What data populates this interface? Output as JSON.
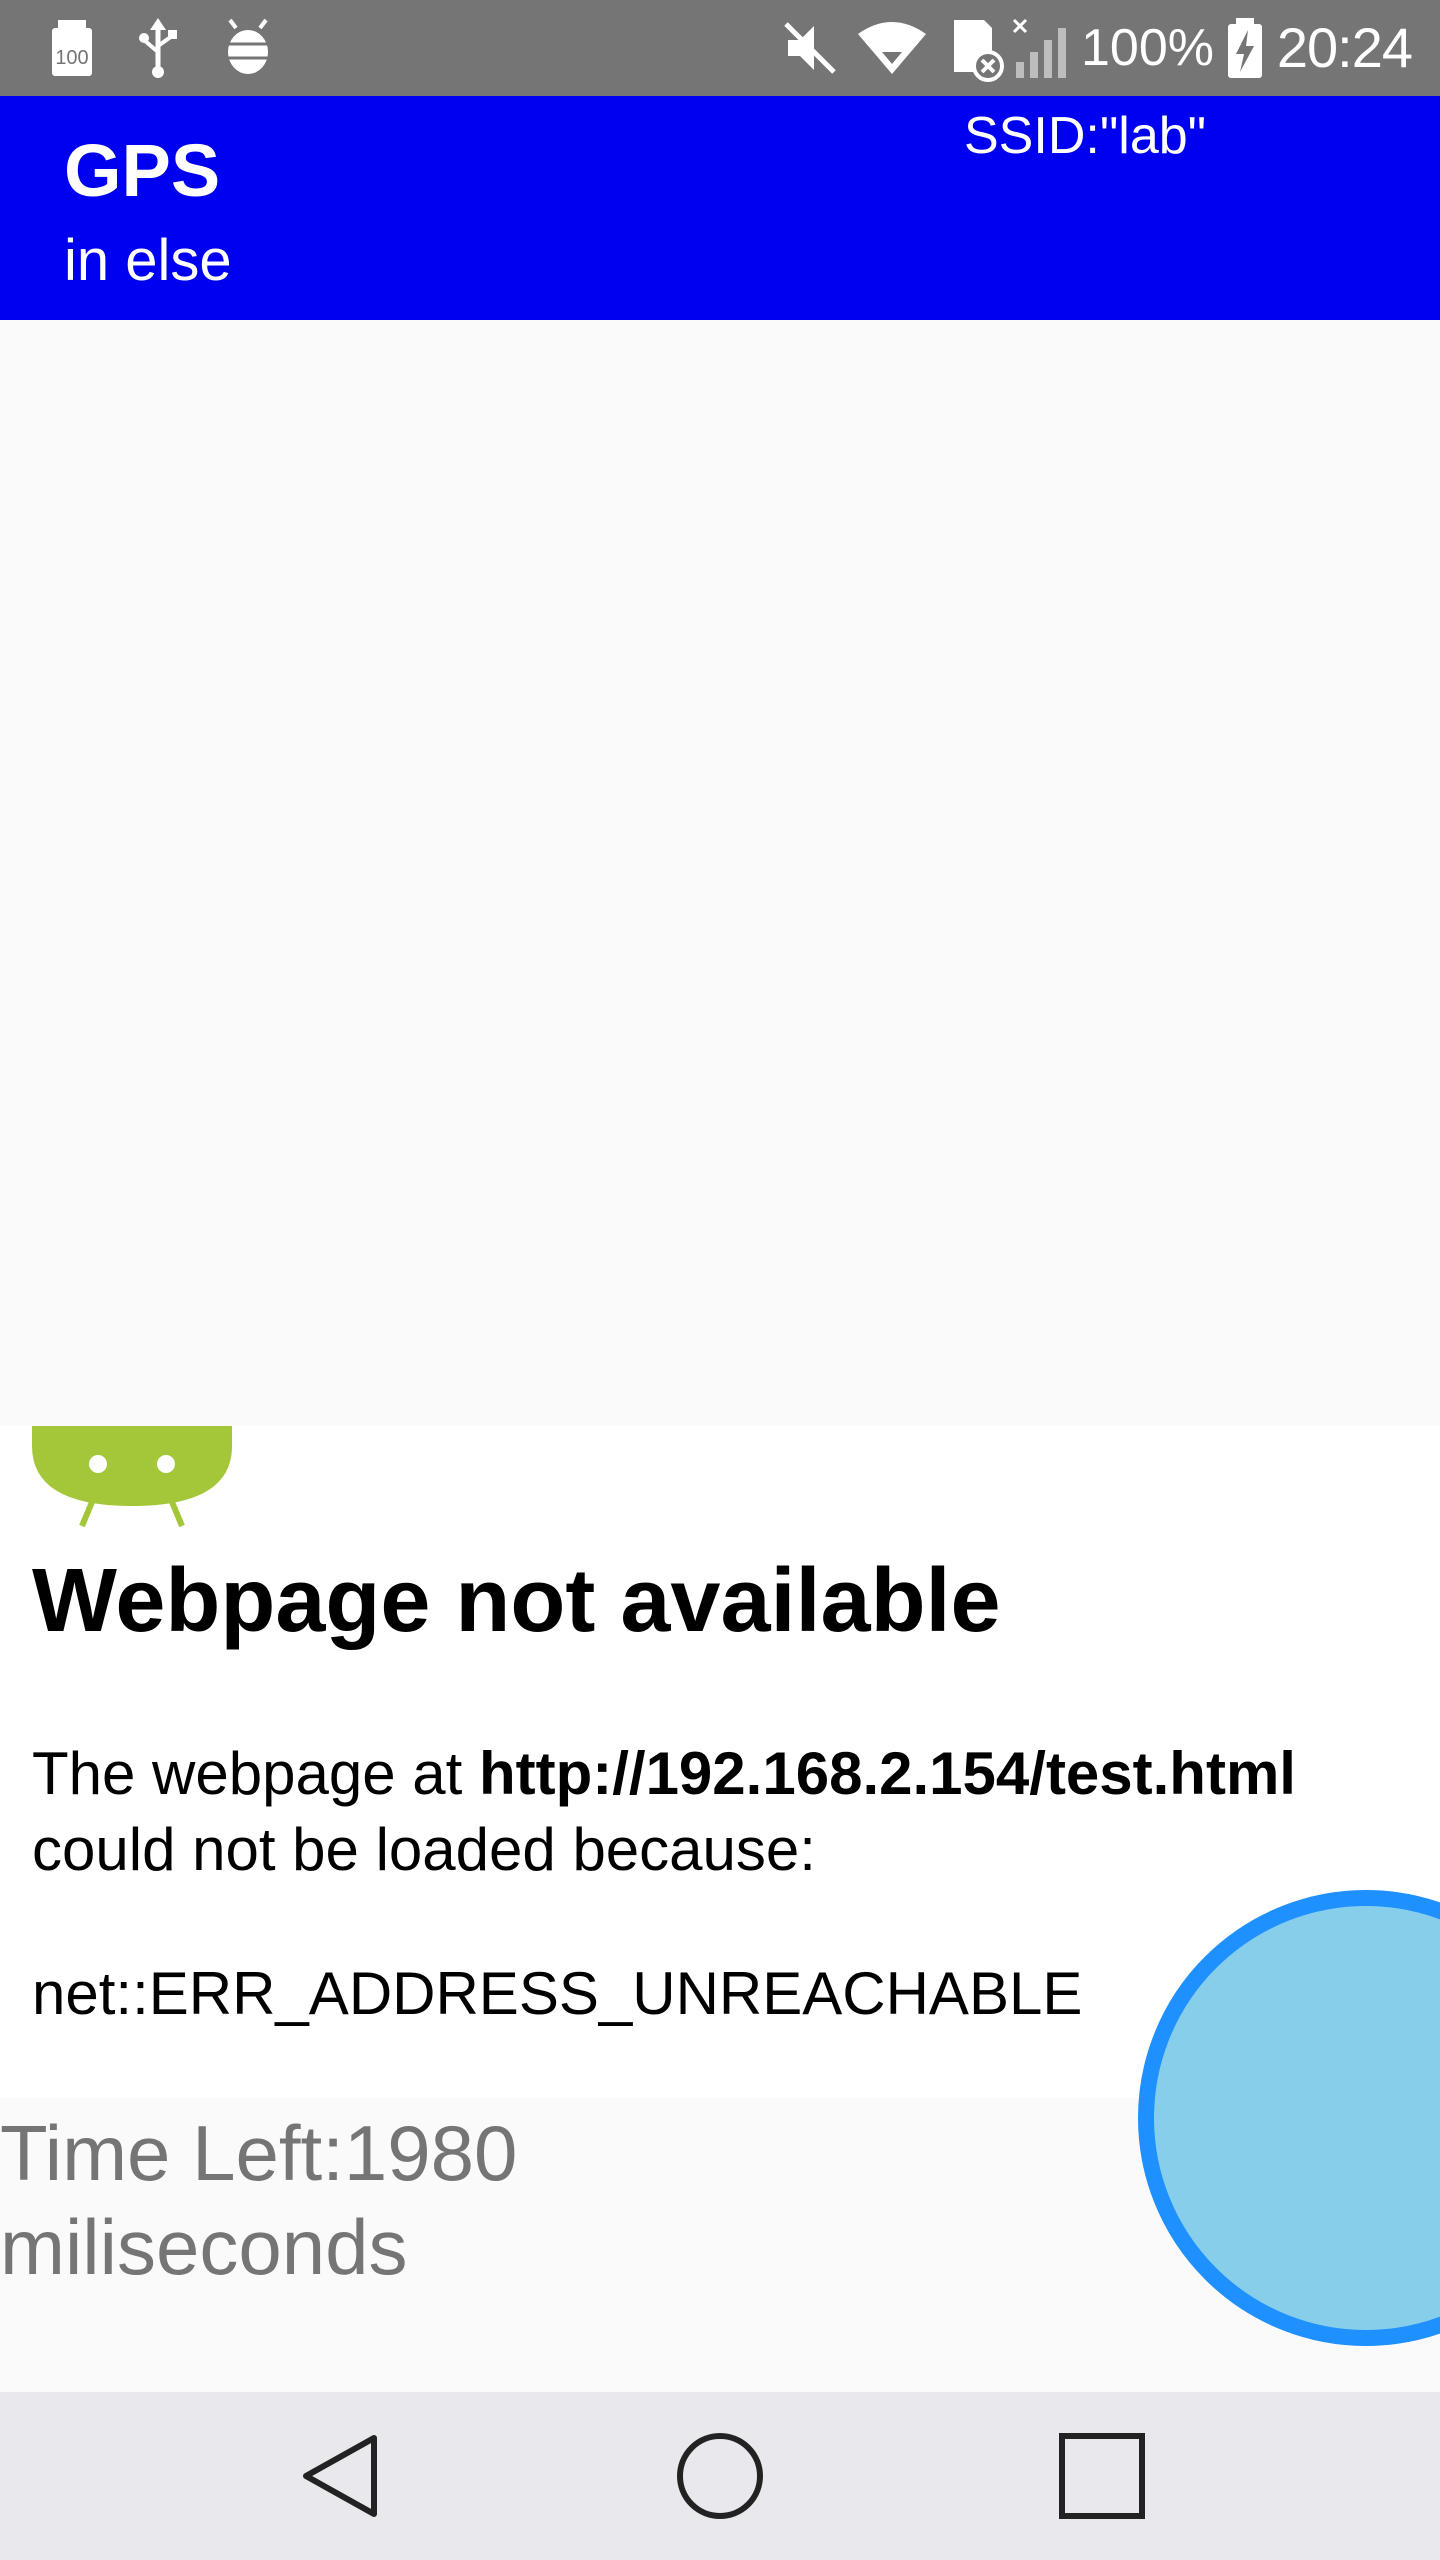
{
  "status_bar": {
    "icons_left": [
      "storage-100-icon",
      "usb-icon",
      "android-debug-icon"
    ],
    "icons_right": [
      "mute-icon",
      "wifi-icon",
      "sd-card-icon",
      "no-signal-icon",
      "battery-charging-icon"
    ],
    "battery_percent": "100%",
    "time": "20:24"
  },
  "app_bar": {
    "title": "GPS",
    "subtitle": "in else",
    "ssid": "SSID:\"lab\"",
    "background_color": "#0000f0"
  },
  "webview": {
    "heading": "Webpage not available",
    "message_prefix": "The webpage at ",
    "url": "http://192.168.2.154/test.html",
    "message_suffix": " could not be loaded because:",
    "error_code": "net::ERR_ADDRESS_UNREACHABLE"
  },
  "timer": {
    "text": "Time Left:1980 miliseconds"
  },
  "fab": {
    "fill_color": "#87ceeb",
    "border_color": "#1e90ff"
  },
  "nav_bar": {
    "buttons": [
      "back-icon",
      "home-icon",
      "recents-icon"
    ]
  }
}
